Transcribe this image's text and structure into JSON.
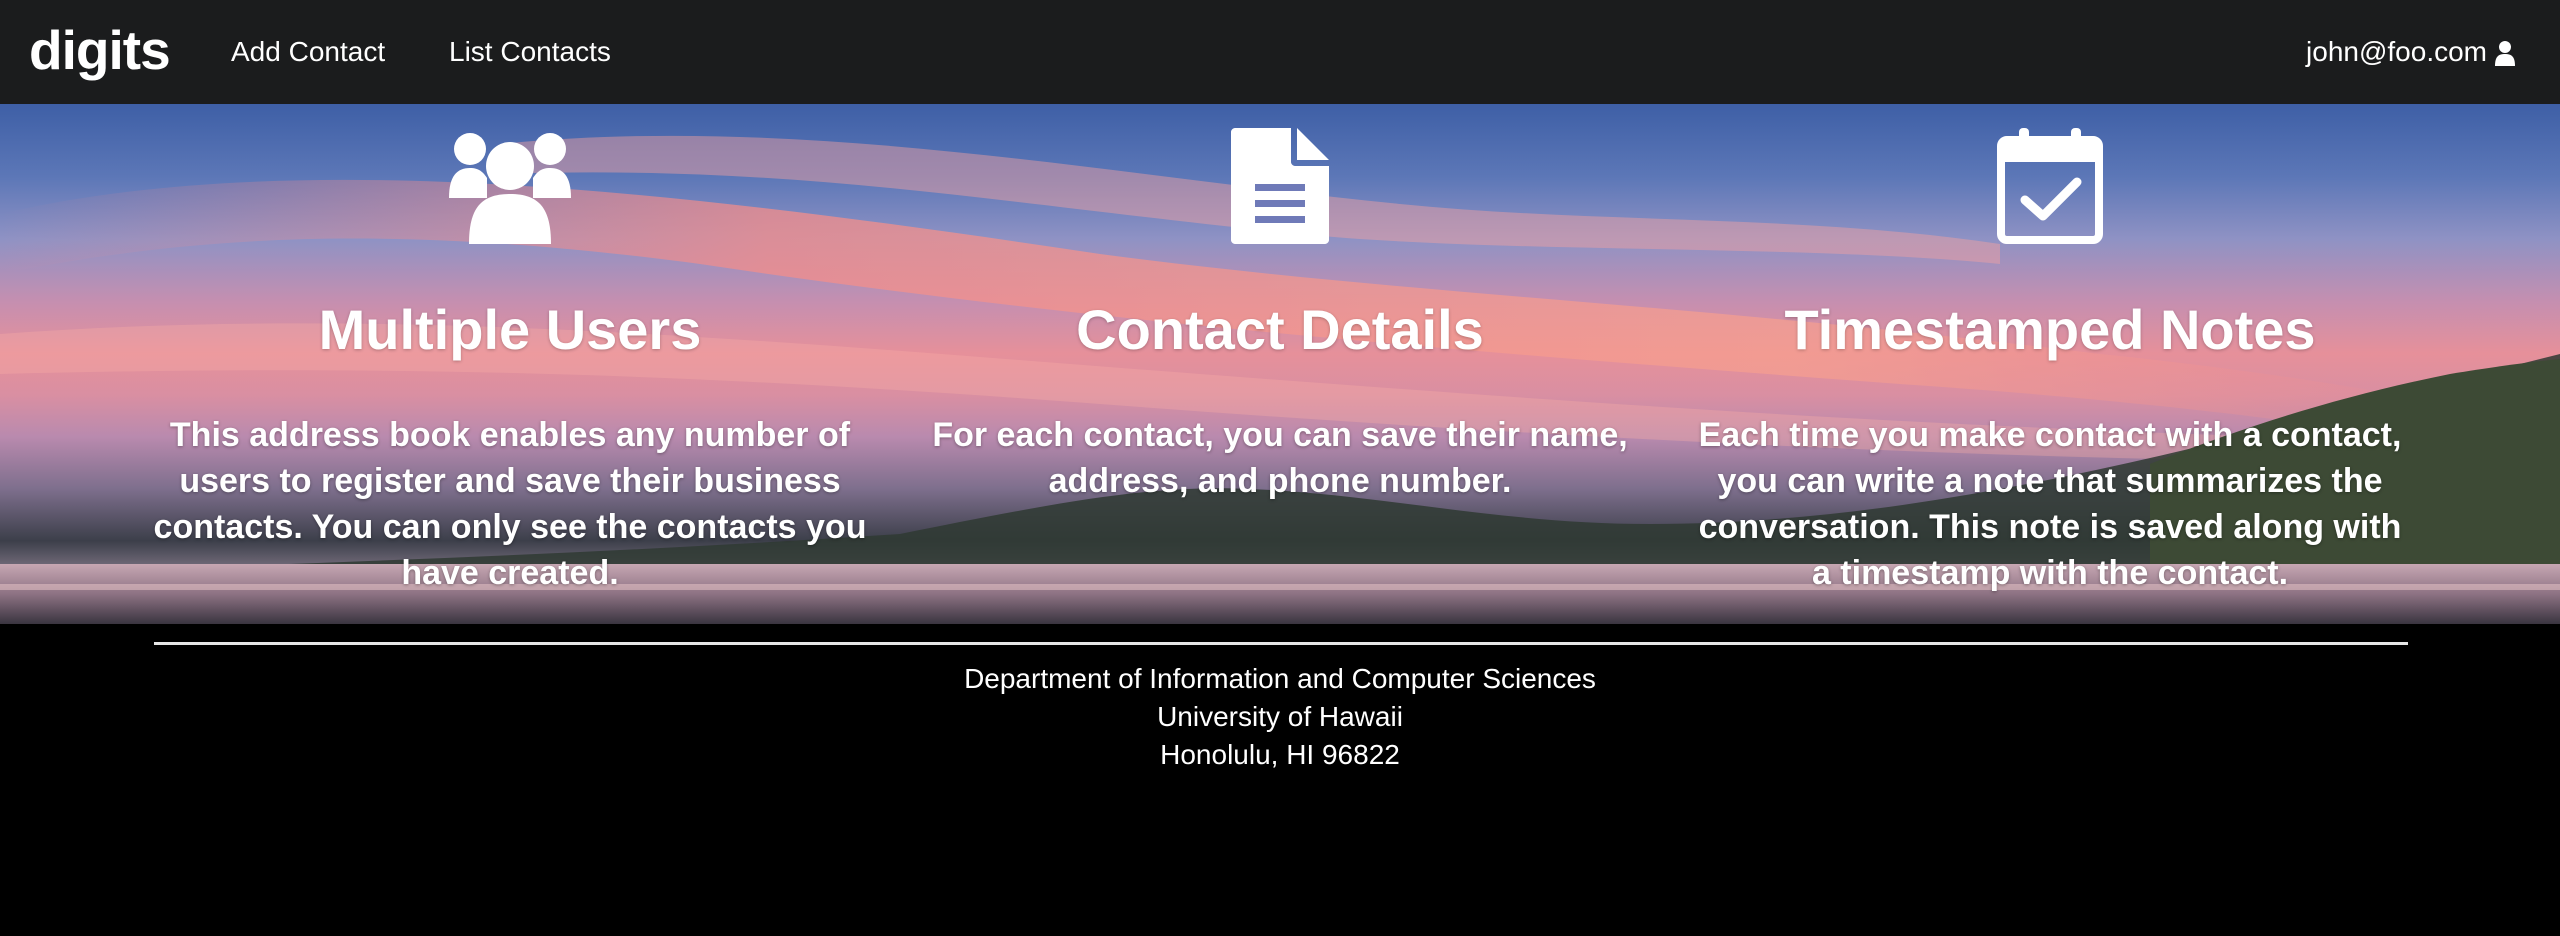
{
  "navbar": {
    "brand": "digits",
    "links": [
      {
        "label": "Add Contact"
      },
      {
        "label": "List Contacts"
      }
    ],
    "user": {
      "email": "john@foo.com",
      "icon": "user-icon"
    }
  },
  "features": [
    {
      "icon": "users-icon",
      "title": "Multiple Users",
      "text": "This address book enables any number of users to register and save their business contacts. You can only see the contacts you have created."
    },
    {
      "icon": "file-text-icon",
      "title": "Contact Details",
      "text": "For each contact, you can save their name, address, and phone number."
    },
    {
      "icon": "calendar-check-icon",
      "title": "Timestamped Notes",
      "text": "Each time you make contact with a contact, you can write a note that summarizes the conversation. This note is saved along with a timestamp with the contact."
    }
  ],
  "footer": {
    "lines": [
      "Department of Information and Computer Sciences",
      "University of Hawaii",
      "Honolulu, HI 96822"
    ]
  },
  "colors": {
    "navbar": "#1b1c1d",
    "footer": "#000000",
    "text": "#ffffff"
  }
}
